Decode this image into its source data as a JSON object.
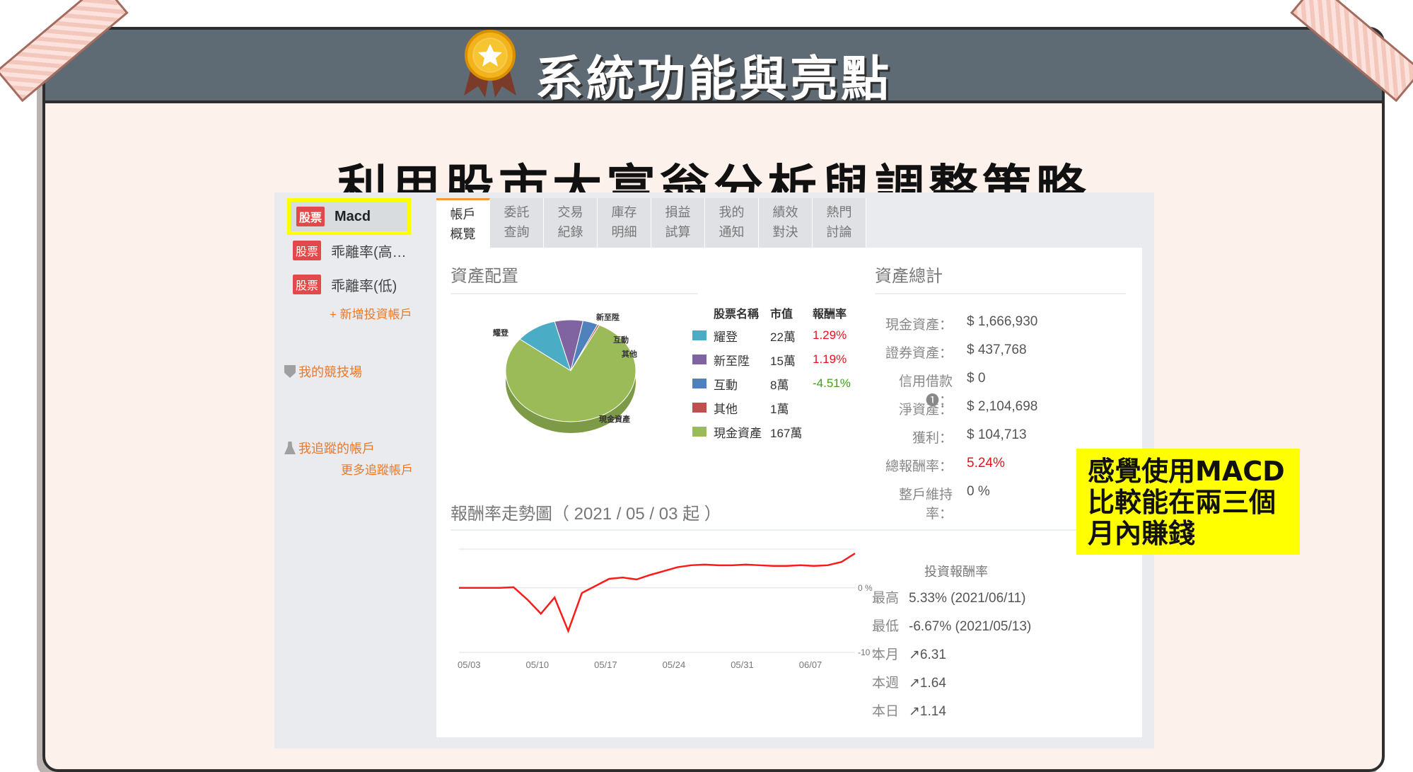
{
  "header": {
    "title": "系統功能與亮點"
  },
  "subtitle": "利用股市大富翁分析與調整策略",
  "sidebar": {
    "items": [
      {
        "badge": "股票",
        "label": "Macd"
      },
      {
        "badge": "股票",
        "label": "乖離率(高…"
      },
      {
        "badge": "股票",
        "label": "乖離率(低)"
      }
    ],
    "add_account": "+ 新增投資帳戶",
    "arena": "我的競技場",
    "following": "我追蹤的帳戶",
    "more_following": "更多追蹤帳戶"
  },
  "tabs": [
    {
      "line1": "帳戶",
      "line2": "概覽"
    },
    {
      "line1": "委託",
      "line2": "查詢"
    },
    {
      "line1": "交易",
      "line2": "紀錄"
    },
    {
      "line1": "庫存",
      "line2": "明細"
    },
    {
      "line1": "損益",
      "line2": "試算"
    },
    {
      "line1": "我的",
      "line2": "通知"
    },
    {
      "line1": "績效",
      "line2": "對決"
    },
    {
      "line1": "熱門",
      "line2": "討論"
    }
  ],
  "allocation": {
    "title": "資產配置",
    "headers": {
      "name": "股票名稱",
      "value": "市值",
      "return": "報酬率"
    },
    "pie_labels": [
      "耀登",
      "新至陞",
      "互動",
      "其他",
      "現金資產"
    ],
    "rows": [
      {
        "name": "耀登",
        "value": "22萬",
        "return": "1.29%",
        "color": "#4bacc6"
      },
      {
        "name": "新至陞",
        "value": "15萬",
        "return": "1.19%",
        "color": "#8064a2"
      },
      {
        "name": "互動",
        "value": "8萬",
        "return": "-4.51%",
        "color": "#4f81bd"
      },
      {
        "name": "其他",
        "value": "1萬",
        "return": "",
        "color": "#c0504d"
      },
      {
        "name": "現金資產",
        "value": "167萬",
        "return": "",
        "color": "#9bbb59"
      }
    ]
  },
  "summary": {
    "title": "資產總計",
    "rows": [
      {
        "label": "現金資產：",
        "value": "$ 1,666,930"
      },
      {
        "label": "證券資產：",
        "value": "$ 437,768"
      },
      {
        "label": "信用借款 ❶：",
        "value": "$ 0"
      },
      {
        "label": "淨資產：",
        "value": "$ 2,104,698"
      },
      {
        "label": "獲利：",
        "value": "$ 104,713"
      },
      {
        "label": "總報酬率：",
        "value": "5.24%"
      },
      {
        "label": "整戶維持率：",
        "value": "0 %"
      }
    ]
  },
  "trend": {
    "title": "報酬率走勢圖（ 2021 / 05 / 03 起 ）",
    "stats_title": "投資報酬率",
    "stats": [
      {
        "label": "最高",
        "value": "5.33% (2021/06/11)"
      },
      {
        "label": "最低",
        "value": "-6.67% (2021/05/13)"
      },
      {
        "label": "本月",
        "value": "↗6.31"
      },
      {
        "label": "本週",
        "value": "↗1.64"
      },
      {
        "label": "本日",
        "value": "↗1.14"
      }
    ]
  },
  "chart_data": {
    "type": "line",
    "x": [
      "05/03",
      "05/04",
      "05/05",
      "05/06",
      "05/07",
      "05/10",
      "05/11",
      "05/12",
      "05/13",
      "05/14",
      "05/17",
      "05/18",
      "05/19",
      "05/20",
      "05/21",
      "05/24",
      "05/25",
      "05/26",
      "05/27",
      "05/28",
      "05/31",
      "06/01",
      "06/02",
      "06/03",
      "06/04",
      "06/07",
      "06/08",
      "06/09",
      "06/10",
      "06/11"
    ],
    "values": [
      0.0,
      0.0,
      0.0,
      0.0,
      0.1,
      -1.8,
      -4.0,
      -1.5,
      -6.67,
      -0.8,
      0.3,
      1.4,
      1.6,
      1.3,
      2.0,
      2.6,
      3.2,
      3.5,
      3.6,
      3.5,
      3.5,
      3.6,
      3.5,
      3.4,
      3.4,
      3.5,
      3.4,
      3.5,
      4.0,
      5.33
    ],
    "xticks": [
      "05/03",
      "05/10",
      "05/17",
      "05/24",
      "05/31",
      "06/07"
    ],
    "yticks": [
      "0 %",
      "-10 %"
    ],
    "ylim": [
      -10,
      6
    ],
    "color": "#ff1a1a",
    "pie": {
      "labels": [
        "耀登",
        "新至陞",
        "互動",
        "其他",
        "現金資產"
      ],
      "values": [
        22,
        15,
        8,
        1,
        167
      ]
    }
  },
  "note": {
    "lines": [
      "感覺使用MACD",
      "比較能在兩三個",
      "月內賺錢"
    ]
  }
}
